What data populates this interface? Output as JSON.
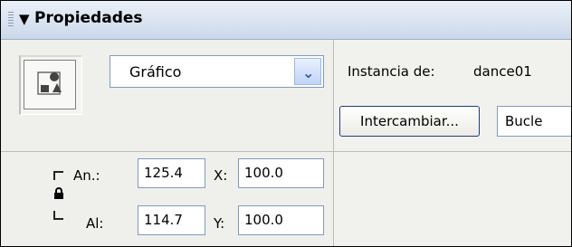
{
  "panel": {
    "title": "Propiedades",
    "collapse_icon": "triangle-down-icon",
    "grip_icon": "panel-grip-icon"
  },
  "symbol": {
    "type_value": "Gráfico",
    "icon": "graphic-symbol-icon",
    "dropdown_icon": "chevron-down-icon"
  },
  "instance": {
    "label": "Instancia de:",
    "value": "dance01",
    "swap_label": "Intercambiar...",
    "loop_value": "Bucle"
  },
  "dimensions": {
    "width_label": "An.:",
    "width_value": "125.4",
    "height_label": "Al:",
    "height_value": "114.7",
    "x_label": "X:",
    "x_value": "100.0",
    "y_label": "Y:",
    "y_value": "100.0",
    "lock_icon": "padlock-icon"
  },
  "colors": {
    "title_bar_top": "#eaf0f8",
    "title_bar_bottom": "#cbd8ea",
    "field_border": "#7f9db9",
    "button_border": "#1f3c88",
    "dropdown_accent": "#2957b8"
  }
}
